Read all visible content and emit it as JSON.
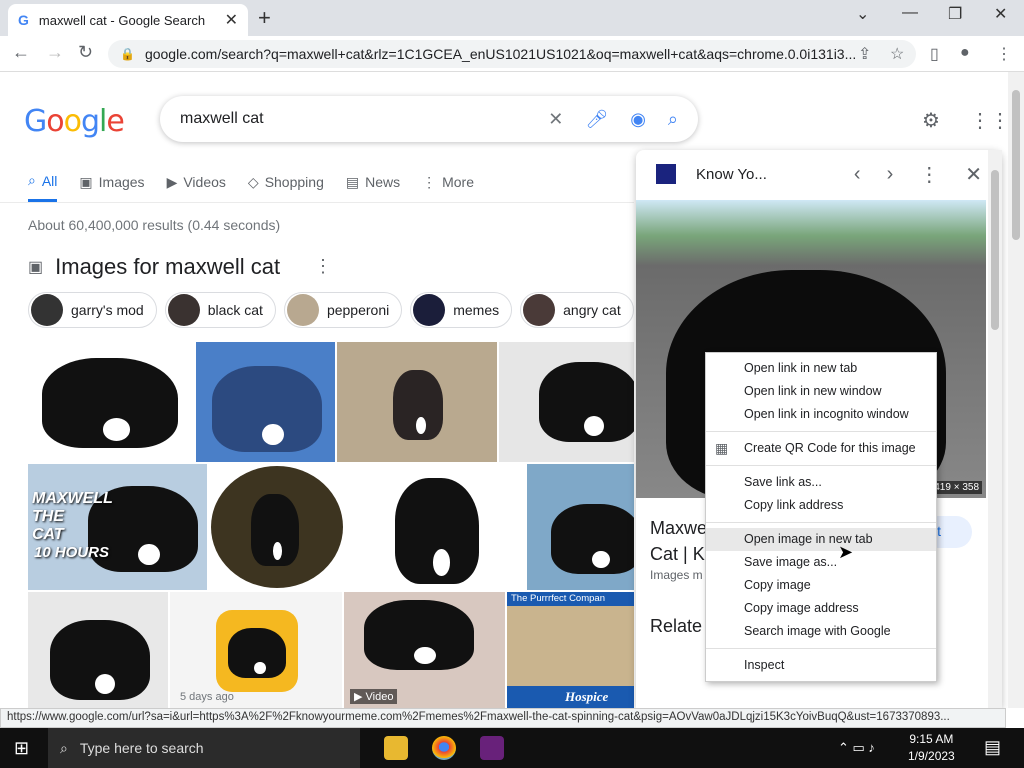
{
  "browser": {
    "tab_title": "maxwell cat - Google Search",
    "tab_close": "✕",
    "new_tab": "+",
    "url": "google.com/search?q=maxwell+cat&rlz=1C1GCEA_enUS1021US1021&oq=maxwell+cat&aqs=chrome.0.0i131i3...",
    "window_controls": {
      "collapse": "⌄",
      "minimize": "—",
      "restore": "❐",
      "close": "✕"
    }
  },
  "search": {
    "logo_letters": [
      "G",
      "o",
      "o",
      "g",
      "l",
      "e"
    ],
    "query": "maxwell cat",
    "tabs": [
      {
        "label": "All",
        "icon": "search-icon",
        "active": true
      },
      {
        "label": "Images",
        "icon": "image-icon"
      },
      {
        "label": "Videos",
        "icon": "video-icon"
      },
      {
        "label": "Shopping",
        "icon": "tag-icon"
      },
      {
        "label": "News",
        "icon": "news-icon"
      },
      {
        "label": "More",
        "icon": "more-icon"
      }
    ],
    "stats": "About 60,400,000 results (0.44 seconds)"
  },
  "images_section": {
    "heading": "Images for maxwell cat",
    "chips": [
      "garry's mod",
      "black cat",
      "pepperoni",
      "memes",
      "angry cat"
    ],
    "overlays": {
      "maxwell_caption": "MAXWELL THE CAT",
      "hours_caption": "10 HOURS",
      "days_ago": "5 days ago",
      "video": "▶ Video",
      "purrrfect": "The Purrrfect Compan",
      "hospice": "Hospice"
    }
  },
  "knowledge_panel": {
    "source_title": "Know Yo...",
    "image_dimensions": "419 × 358",
    "title_line1": "Maxwe",
    "title_line2": "Cat | K",
    "visit_fragment": "it",
    "images_fragment": "Images m",
    "related_fragment": "Relate"
  },
  "context_menu": {
    "groups": [
      [
        "Open link in new tab",
        "Open link in new window",
        "Open link in incognito window"
      ],
      [
        "Create QR Code for this image"
      ],
      [
        "Save link as...",
        "Copy link address"
      ],
      [
        "Open image in new tab",
        "Save image as...",
        "Copy image",
        "Copy image address",
        "Search image with Google"
      ],
      [
        "Inspect"
      ]
    ],
    "hovered": "Open image in new tab"
  },
  "status_url": "https://www.google.com/url?sa=i&url=https%3A%2F%2Fknowyourmeme.com%2Fmemes%2Fmaxwell-the-cat-spinning-cat&psig=AOvVaw0aJDLqjzi15K3cYoivBuqQ&ust=1673370893...",
  "taskbar": {
    "search_placeholder": "Type here to search",
    "time": "9:15 AM",
    "date": "1/9/2023"
  },
  "colors": {
    "google_blue": "#4285f4",
    "active_tab": "#1a73e8"
  }
}
